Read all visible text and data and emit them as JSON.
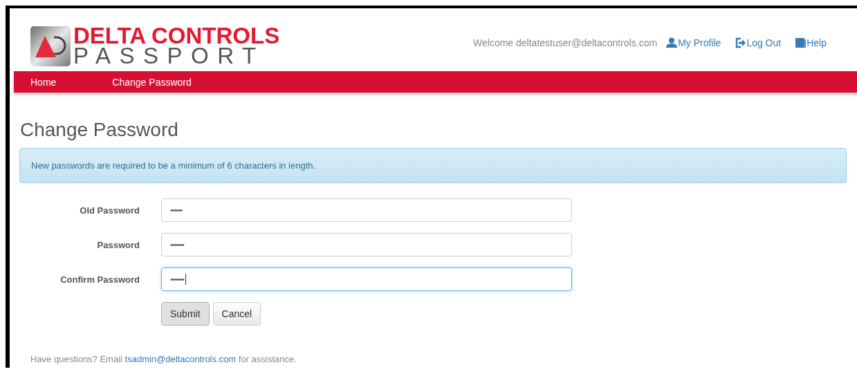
{
  "logo": {
    "line_1": "DELTA CONTROLS",
    "line_2": "PASSPORT"
  },
  "header": {
    "welcome": "Welcome deltatestuser@deltacontrols.com",
    "links": [
      {
        "kind": "profile",
        "label": "My Profile"
      },
      {
        "kind": "logout",
        "label": "Log Out"
      },
      {
        "kind": "help",
        "label": "Help"
      }
    ]
  },
  "nav": [
    {
      "label": "Home"
    },
    {
      "label": "Change Password"
    }
  ],
  "title": "Change Password",
  "alert": "New passwords are required to be a minimum of 6 characters in length.",
  "fields": [
    {
      "label": "Old Password",
      "value": "••••••",
      "focused": false
    },
    {
      "label": "Password",
      "value": "•••••••",
      "focused": false
    },
    {
      "label": "Confirm Password",
      "value": "•••••••",
      "focused": true
    }
  ],
  "buttons": [
    {
      "label": "Submit",
      "kind": "primary"
    },
    {
      "label": "Cancel",
      "kind": "default"
    }
  ],
  "footer": {
    "before": "Have questions? Email",
    "link": "tsadmin@deltacontrols.com",
    "after": "for assistance."
  }
}
